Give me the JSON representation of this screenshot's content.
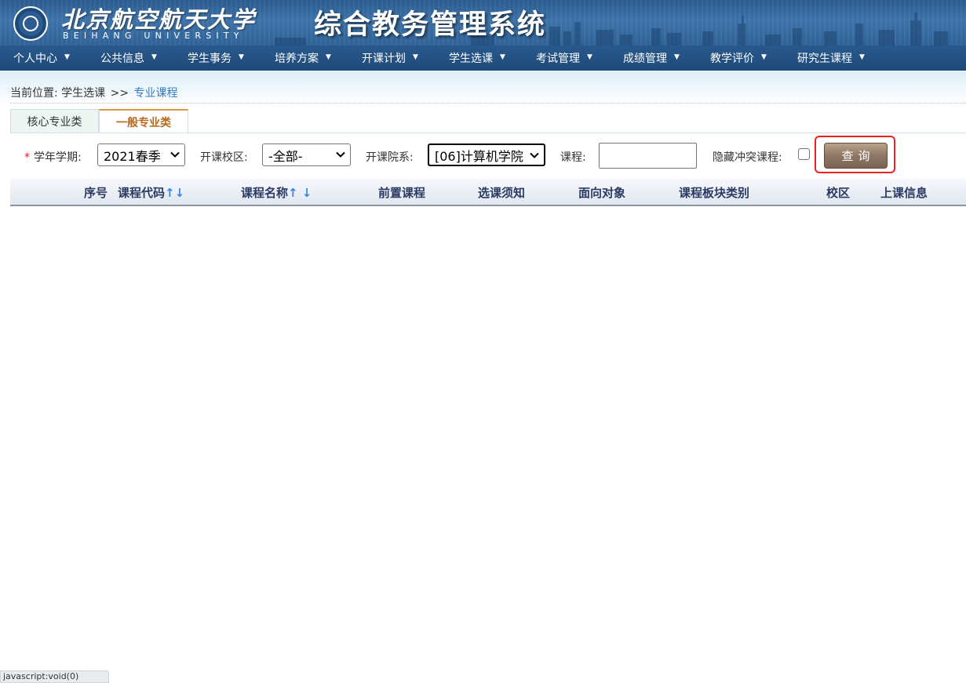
{
  "header": {
    "univ_name_cn": "北京航空航天大学",
    "univ_name_en": "BEIHANG UNIVERSITY",
    "system_title": "综合教务管理系统"
  },
  "nav": {
    "items": [
      {
        "label": "个人中心"
      },
      {
        "label": "公共信息"
      },
      {
        "label": "学生事务"
      },
      {
        "label": "培养方案"
      },
      {
        "label": "开课计划"
      },
      {
        "label": "学生选课"
      },
      {
        "label": "考试管理"
      },
      {
        "label": "成绩管理"
      },
      {
        "label": "教学评价"
      },
      {
        "label": "研究生课程"
      }
    ],
    "caret": "▼"
  },
  "breadcrumb": {
    "prefix": "当前位置:",
    "parent": "学生选课",
    "separator": ">>",
    "current": "专业课程"
  },
  "tabs": [
    {
      "label": "核心专业类",
      "active": false
    },
    {
      "label": "一般专业类",
      "active": true
    }
  ],
  "filters": {
    "required_mark": "*",
    "term_label": "学年学期:",
    "term_value": "2021春季",
    "campus_label": "开课校区:",
    "campus_value": "-全部-",
    "dept_label": "开课院系:",
    "dept_value": "[06]计算机学院",
    "course_label": "课程:",
    "course_value": "",
    "hide_conflict_label": "隐藏冲突课程:",
    "hide_conflict_checked": false,
    "query_button": "查询"
  },
  "table": {
    "columns": [
      {
        "label": "序号",
        "sort": ""
      },
      {
        "label": "课程代码",
        "sort": "↑↓"
      },
      {
        "label": "课程名称",
        "sort": "↑ ↓"
      },
      {
        "label": "前置课程",
        "sort": ""
      },
      {
        "label": "选课须知",
        "sort": ""
      },
      {
        "label": "面向对象",
        "sort": ""
      },
      {
        "label": "课程板块类别",
        "sort": ""
      },
      {
        "label": "校区",
        "sort": ""
      },
      {
        "label": "上课信息",
        "sort": ""
      }
    ],
    "rows": []
  },
  "statusbar": {
    "text": "javascript:void(0)"
  },
  "colors": {
    "header_blue": "#2f6296",
    "nav_blue": "#1e4a7a",
    "tab_active_text": "#b66a1d",
    "link_blue": "#2b7cc7",
    "highlight_red": "#ee1f1f",
    "button_brown": "#8e7764"
  }
}
